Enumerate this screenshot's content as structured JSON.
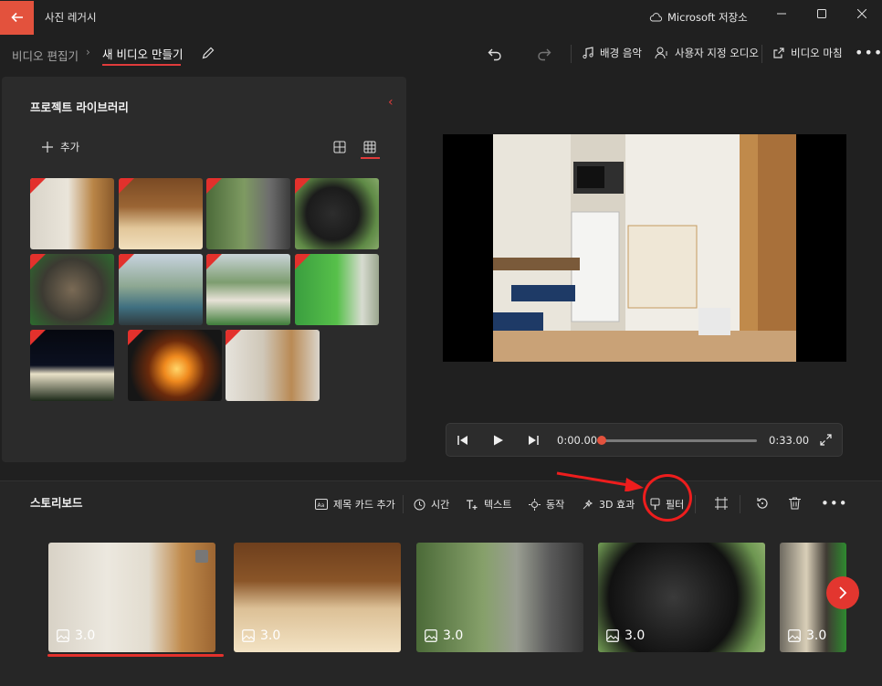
{
  "titlebar": {
    "app_title": "사진 레거시",
    "cloud_label": "Microsoft 저장소"
  },
  "breadcrumb": {
    "parent": "비디오 편집기",
    "current": "새 비디오 만들기"
  },
  "toolbar": {
    "bg_music": "배경 음악",
    "custom_audio": "사용자 지정 오디오",
    "finish_video": "비디오 마침"
  },
  "library": {
    "title": "프로젝트 라이브러리",
    "add_label": "추가"
  },
  "player": {
    "current_time": "0:00.00",
    "total_time": "0:33.00",
    "progress": 0
  },
  "storyboard": {
    "title": "스토리보드",
    "actions": {
      "title_card": "제목 카드 추가",
      "duration": "시간",
      "text": "텍스트",
      "motion": "동작",
      "effects_3d": "3D 효과",
      "filter": "필터"
    },
    "clips": [
      {
        "duration": "3.0"
      },
      {
        "duration": "3.0"
      },
      {
        "duration": "3.0"
      },
      {
        "duration": "3.0"
      },
      {
        "duration": "3.0"
      }
    ]
  },
  "colors": {
    "accent": "#e3523d",
    "selection": "#e3312c",
    "annotation": "#ee1d1d"
  }
}
